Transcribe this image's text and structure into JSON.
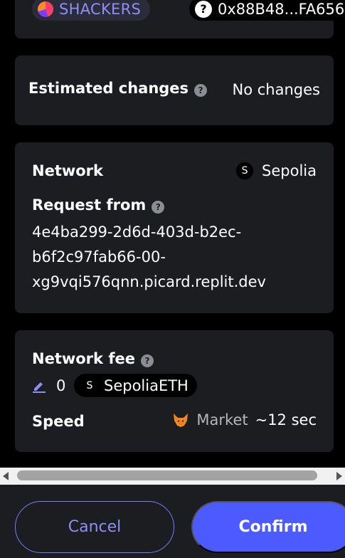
{
  "top": {
    "account_name": "SHACKERS",
    "address": "0x88B48...FA656"
  },
  "estimated": {
    "label": "Estimated changes",
    "value": "No changes"
  },
  "network": {
    "label": "Network",
    "network_icon_letter": "S",
    "value": "Sepolia",
    "request_label": "Request from",
    "origin_lines": [
      "4e4ba299-2d6d-403d-b2ec-",
      "b6f2c97fab66-00-",
      "xg9vqi576qnn.picard.replit.dev"
    ]
  },
  "fee": {
    "label": "Network fee",
    "amount": "0",
    "token_icon_letter": "S",
    "token": "SepoliaETH",
    "speed_label": "Speed",
    "speed_value": "Market",
    "speed_time": "~12 sec"
  },
  "footer": {
    "cancel": "Cancel",
    "confirm": "Confirm"
  },
  "colors": {
    "accent": "#4b5bff",
    "card": "#1c1d21",
    "link": "#8f8ef7"
  }
}
